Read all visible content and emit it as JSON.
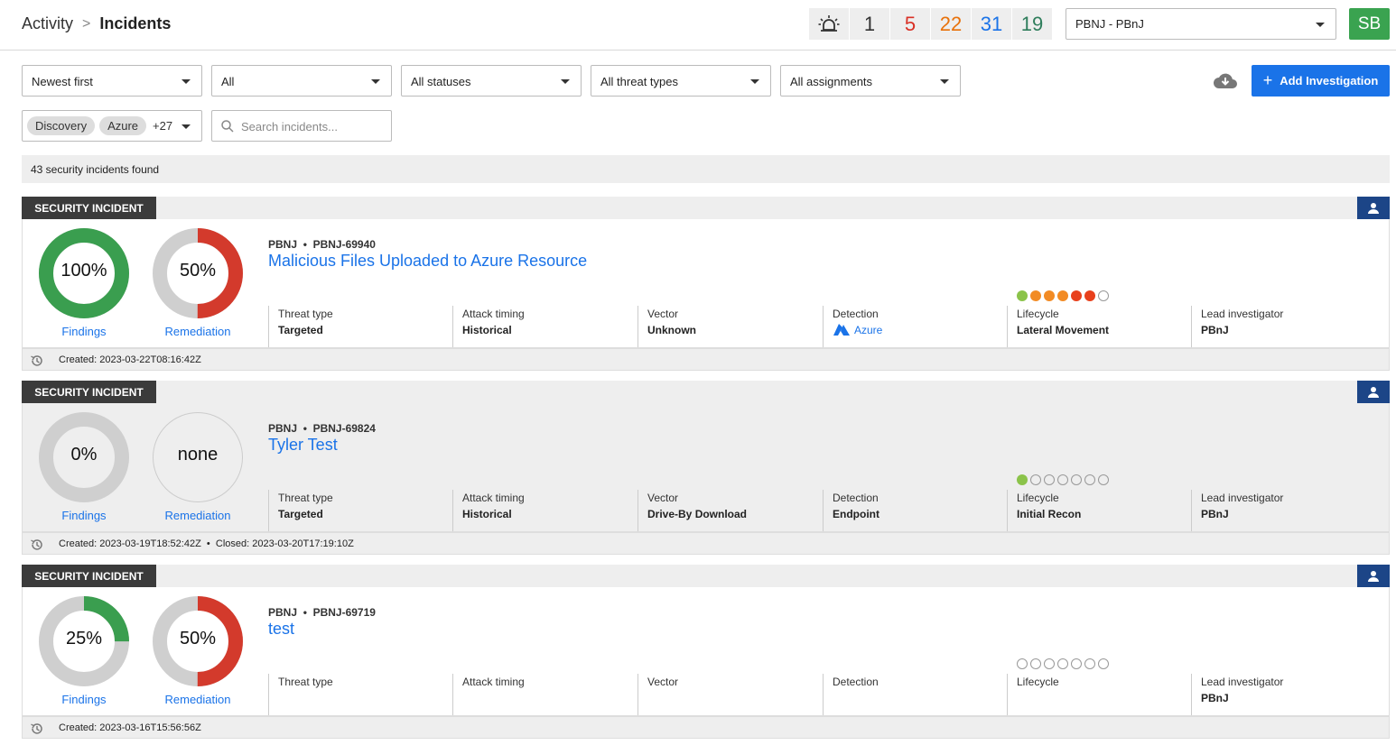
{
  "breadcrumb": {
    "parent": "Activity",
    "separator": ">",
    "current": "Incidents"
  },
  "counters": [
    {
      "value": "1",
      "color": "#333333"
    },
    {
      "value": "5",
      "color": "#d93025"
    },
    {
      "value": "22",
      "color": "#e8710a"
    },
    {
      "value": "31",
      "color": "#1a73e8"
    },
    {
      "value": "19",
      "color": "#2e7d5b"
    }
  ],
  "org_select": {
    "value": "PBNJ - PBnJ"
  },
  "user_avatar": {
    "initials": "SB",
    "color": "#3aa350"
  },
  "filters": {
    "sort": "Newest first",
    "scope": "All",
    "status": "All statuses",
    "threat_type": "All threat types",
    "assignment": "All assignments"
  },
  "add_button": {
    "label": "Add Investigation",
    "icon": "plus-icon"
  },
  "tags": {
    "chips": [
      "Discovery",
      "Azure"
    ],
    "more": "+27"
  },
  "search": {
    "placeholder": "Search incidents..."
  },
  "results_text": "43 security incidents found",
  "attr_labels": {
    "threat_type": "Threat type",
    "attack_timing": "Attack timing",
    "vector": "Vector",
    "detection": "Detection",
    "lifecycle": "Lifecycle",
    "lead_investigator": "Lead investigator"
  },
  "incidents": [
    {
      "label": "SECURITY INCIDENT",
      "org": "PBNJ",
      "bullet": "•",
      "id": "PBNJ-69940",
      "title": "Malicious Files Uploaded to Azure Resource",
      "findings": {
        "text": "100%",
        "fraction": 1.0,
        "color": "#3a9e4f",
        "caption": "Findings"
      },
      "remediation": {
        "text": "50%",
        "fraction": 0.5,
        "color": "#d33a2c",
        "caption": "Remediation"
      },
      "threat_type": "Targeted",
      "attack_timing": "Historical",
      "vector": "Unknown",
      "detection": "Azure",
      "detection_icon": "azure-icon",
      "lifecycle": "Lateral Movement",
      "lifecycle_dots": [
        "#8bc34a",
        "#f28b24",
        "#f28b24",
        "#f28b24",
        "#e8401c",
        "#e8401c",
        "empty"
      ],
      "lead_investigator": "PBnJ",
      "created_label": "Created:",
      "created": "2023-03-22T08:16:42Z",
      "closed_label": "",
      "closed": "",
      "gray": false
    },
    {
      "label": "SECURITY INCIDENT",
      "org": "PBNJ",
      "bullet": "•",
      "id": "PBNJ-69824",
      "title": "Tyler Test",
      "findings": {
        "text": "0%",
        "fraction": 0.0,
        "color": "#3a9e4f",
        "caption": "Findings"
      },
      "remediation": {
        "text": "none",
        "fraction": null,
        "color": "#d33a2c",
        "caption": "Remediation"
      },
      "threat_type": "Targeted",
      "attack_timing": "Historical",
      "vector": "Drive-By Download",
      "detection": "Endpoint",
      "detection_icon": "",
      "lifecycle": "Initial Recon",
      "lifecycle_dots": [
        "#8bc34a",
        "empty",
        "empty",
        "empty",
        "empty",
        "empty",
        "empty"
      ],
      "lead_investigator": "PBnJ",
      "created_label": "Created:",
      "created": "2023-03-19T18:52:42Z",
      "closed_label": "Closed:",
      "closed": "2023-03-20T17:19:10Z",
      "gray": true
    },
    {
      "label": "SECURITY INCIDENT",
      "org": "PBNJ",
      "bullet": "•",
      "id": "PBNJ-69719",
      "title": "test",
      "findings": {
        "text": "25%",
        "fraction": 0.25,
        "color": "#3a9e4f",
        "caption": "Findings"
      },
      "remediation": {
        "text": "50%",
        "fraction": 0.5,
        "color": "#d33a2c",
        "caption": "Remediation"
      },
      "threat_type": "",
      "attack_timing": "",
      "vector": "",
      "detection": "",
      "detection_icon": "",
      "lifecycle": "",
      "lifecycle_dots": [
        "empty",
        "empty",
        "empty",
        "empty",
        "empty",
        "empty",
        "empty"
      ],
      "lead_investigator": "PBnJ",
      "created_label": "Created:",
      "created": "2023-03-16T15:56:56Z",
      "closed_label": "",
      "closed": "",
      "gray": false
    }
  ]
}
